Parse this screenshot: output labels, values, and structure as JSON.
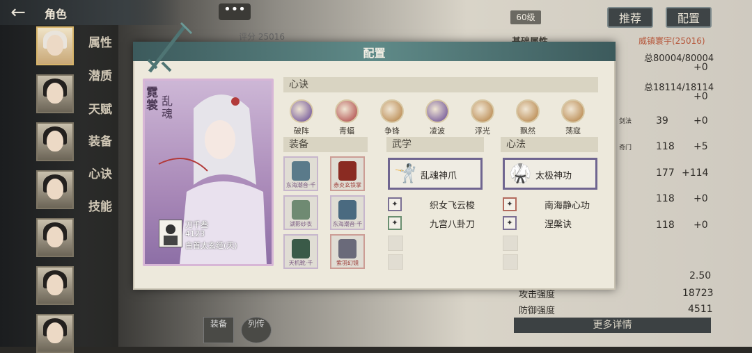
{
  "header": {
    "title": "角色",
    "back_icon": "back-arrow-icon"
  },
  "sidebar": {
    "tabs": [
      "属性",
      "潜质",
      "天赋",
      "装备",
      "心诀",
      "技能"
    ],
    "portraits": 7
  },
  "top": {
    "more_label": "•••",
    "level": "60级",
    "recommend_label": "推荐",
    "config_label": "配置"
  },
  "right_panel": {
    "basic_attr_title": "基础属性",
    "power": "威镇寰宇(25016)",
    "stat1_total": "总80004/80004",
    "stat1_delta": "+0",
    "stat2_total": "总18114/18114",
    "stat2_delta": "+0",
    "rows": [
      {
        "label": "剑法",
        "value": "39",
        "delta": "+0"
      },
      {
        "label": "奇门",
        "value": "118",
        "delta": "+5"
      },
      {
        "label": "",
        "value": "177",
        "delta": "+114"
      },
      {
        "label": "",
        "value": "118",
        "delta": "+0"
      },
      {
        "label": "",
        "value": "118",
        "delta": "+0"
      }
    ],
    "val_250": "2.50",
    "attack_label": "攻击强度",
    "attack_value": "18723",
    "defense_label": "防御强度",
    "defense_value": "4511",
    "more_detail": "更多详情"
  },
  "score_label": "评分 25016",
  "modal": {
    "title": "配置",
    "character": {
      "name": "霓裳",
      "title": "乱魂",
      "owner_name": "刀千叁",
      "owner_id": "4123",
      "owner_method": "白首太玄经(天)"
    },
    "xinjue": {
      "header": "心诀",
      "skills": [
        {
          "name": "破阵",
          "color": "#5e3f8f"
        },
        {
          "name": "青蝠",
          "color": "#a8383a"
        },
        {
          "name": "争锋",
          "color": "#b07a3a"
        },
        {
          "name": "凌波",
          "color": "#5e3f8f"
        },
        {
          "name": "浮光",
          "color": "#b07a3a"
        },
        {
          "name": "飘然",
          "color": "#b07a3a"
        },
        {
          "name": "荡寇",
          "color": "#b07a3a"
        }
      ]
    },
    "equipment": {
      "header": "装备",
      "items": [
        {
          "name": "东海潮音·千",
          "color": "#5a7a8a",
          "rarity": "purple"
        },
        {
          "name": "赤炎玄铁掌",
          "color": "#8a2b22",
          "rarity": "red"
        },
        {
          "name": "湖影纱衣",
          "color": "#6f8a72",
          "rarity": "purple"
        },
        {
          "name": "东海潮音·千",
          "color": "#4a6a80",
          "rarity": "purple"
        },
        {
          "name": "天机靴·千",
          "color": "#3a5a48",
          "rarity": "purple"
        },
        {
          "name": "紫羽幻镜",
          "color": "#6a6a7a",
          "rarity": "red"
        }
      ]
    },
    "wuxue": {
      "header": "武学",
      "main": "乱魂神爪",
      "subs": [
        "织女飞云梭",
        "九宫八卦刀"
      ]
    },
    "xinfa": {
      "header": "心法",
      "main": "太极神功",
      "subs": [
        "南海静心功",
        "涅槃诀"
      ]
    }
  },
  "bottom_tabs": [
    "装备",
    "列传"
  ]
}
